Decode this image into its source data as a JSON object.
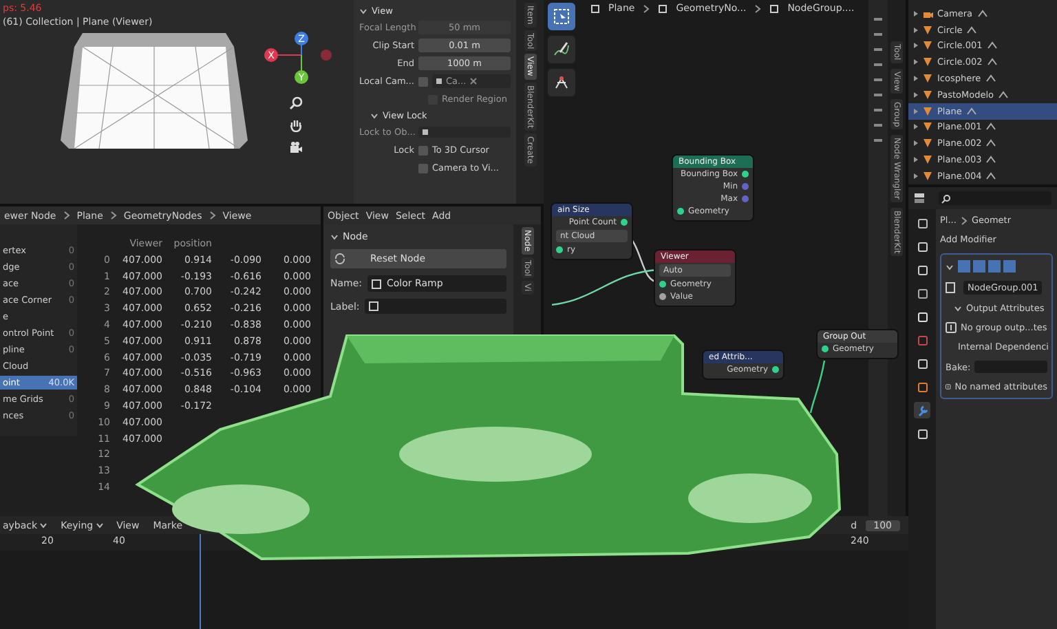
{
  "viewport": {
    "fps": "ps: 5.46",
    "info": "(61) Collection | Plane (Viewer)",
    "gizmo": [
      "X",
      "Y",
      "Z"
    ],
    "sidebar": {
      "section": "View",
      "fields": [
        {
          "label": "Focal Length",
          "value": "50 mm",
          "disabled": true
        },
        {
          "label": "Clip Start",
          "value": "0.01 m",
          "disabled": false
        },
        {
          "label": "End",
          "value": "1000 m",
          "disabled": false
        }
      ],
      "local_camera": {
        "label": "Local Cam...",
        "value": "Ca...",
        "checked": false
      },
      "render_region": {
        "label": "Render Region",
        "checked": false,
        "disabled": true
      },
      "view_lock": "View Lock",
      "lock_to_object": {
        "label": "Lock to Ob...",
        "disabled": true
      },
      "lock_label": "Lock",
      "lock_options": [
        {
          "label": "To 3D Cursor",
          "checked": false
        },
        {
          "label": "Camera to Vi...",
          "checked": false
        }
      ]
    },
    "tabs": [
      {
        "label": "Item",
        "selected": false
      },
      {
        "label": "Tool",
        "selected": false
      },
      {
        "label": "View",
        "selected": true
      },
      {
        "label": "BlenderKit",
        "selected": false
      },
      {
        "label": "Create",
        "selected": false
      }
    ]
  },
  "spreadsheet": {
    "breadcrumbs": [
      "ewer Node",
      "Plane",
      "GeometryNodes",
      "Viewe"
    ],
    "domains": [
      {
        "label": "ertex",
        "count": "0",
        "selected": false
      },
      {
        "label": "dge",
        "count": "0",
        "selected": false
      },
      {
        "label": "ace",
        "count": "0",
        "selected": false
      },
      {
        "label": "ace Corner",
        "count": "0",
        "selected": false
      },
      {
        "label": "e",
        "selected": false
      },
      {
        "label": "ontrol Point",
        "count": "0",
        "selected": false
      },
      {
        "label": "pline",
        "count": "0",
        "selected": false
      },
      {
        "label": "Cloud",
        "selected": false
      },
      {
        "label": "oint",
        "count": "40.0K",
        "selected": true
      },
      {
        "label": "me Grids",
        "count": "0",
        "selected": false
      },
      {
        "label": "nces",
        "count": "0",
        "selected": false
      }
    ],
    "columns": [
      "Viewer",
      "position"
    ],
    "rows": [
      {
        "index": "0",
        "cells": [
          "407.000",
          "0.914",
          "-0.090",
          "0.000"
        ]
      },
      {
        "index": "1",
        "cells": [
          "407.000",
          "-0.193",
          "-0.616",
          "0.000"
        ]
      },
      {
        "index": "2",
        "cells": [
          "407.000",
          "0.700",
          "-0.242",
          "0.000"
        ]
      },
      {
        "index": "3",
        "cells": [
          "407.000",
          "0.652",
          "-0.216",
          "0.000"
        ]
      },
      {
        "index": "4",
        "cells": [
          "407.000",
          "-0.210",
          "-0.838",
          "0.000"
        ]
      },
      {
        "index": "5",
        "cells": [
          "407.000",
          "0.911",
          "0.878",
          "0.000"
        ]
      },
      {
        "index": "6",
        "cells": [
          "407.000",
          "-0.035",
          "-0.719",
          "0.000"
        ]
      },
      {
        "index": "7",
        "cells": [
          "407.000",
          "-0.516",
          "-0.963",
          "0.000"
        ]
      },
      {
        "index": "8",
        "cells": [
          "407.000",
          "0.848",
          "-0.104",
          "0.000"
        ]
      },
      {
        "index": "9",
        "cells": [
          "407.000",
          "-0.172"
        ]
      },
      {
        "index": "10",
        "cells": [
          "407.000"
        ]
      },
      {
        "index": "11",
        "cells": [
          "407.000"
        ]
      },
      {
        "index": "12",
        "cells": []
      },
      {
        "index": "13",
        "cells": []
      },
      {
        "index": "14",
        "cells": []
      }
    ]
  },
  "node_panel": {
    "menus": [
      "Object",
      "View",
      "Select",
      "Add"
    ],
    "section": "Node",
    "reset": "Reset Node",
    "name_label": "Name:",
    "name_value": "Color Ramp",
    "label_label": "Label:",
    "tabs": [
      {
        "label": "Node",
        "selected": true
      },
      {
        "label": "Tool",
        "selected": false
      },
      {
        "label": "Vi",
        "selected": false
      }
    ]
  },
  "node_editor": {
    "breadcrumbs": [
      "Plane",
      "GeometryNo...",
      "NodeGroup...."
    ],
    "tools": [
      {
        "kind": "select",
        "selected": true
      },
      {
        "kind": "annotate",
        "selected": false
      },
      {
        "kind": "measure",
        "selected": false
      }
    ],
    "nodes": [
      {
        "title": "Bounding Box",
        "color": "#1d6e55",
        "sockets": [
          {
            "label": "Bounding Box",
            "kind": "output",
            "color": "#2fd28a"
          },
          {
            "label": "Min",
            "kind": "output",
            "color": "#6363c7"
          },
          {
            "label": "Max",
            "kind": "output",
            "color": "#6363c7"
          },
          {
            "label": "Geometry",
            "kind": "input",
            "color": "#2fd28a"
          }
        ]
      },
      {
        "title": "ain Size",
        "color": "#27365e",
        "sockets": [
          {
            "label": "Point Count",
            "kind": "output",
            "color": "#2fd28a"
          },
          {
            "label": "nt Cloud",
            "kind": "menu"
          },
          {
            "label": "ry",
            "kind": "input",
            "color": "#2fd28a"
          }
        ]
      },
      {
        "title": "Viewer",
        "color": "#6a2232",
        "sockets": [
          {
            "label": "Auto",
            "kind": "menu"
          },
          {
            "label": "Geometry",
            "kind": "input",
            "color": "#2fd28a"
          },
          {
            "label": "Value",
            "kind": "input",
            "color": "#a1a1a1"
          }
        ]
      },
      {
        "title": "ed Attrib...",
        "color": "#27365e",
        "sockets": [
          {
            "label": "Geometry",
            "kind": "output",
            "color": "#2fd28a"
          }
        ]
      },
      {
        "title": "Group Out",
        "color": "#3a3a3a",
        "sockets": [
          {
            "label": "Geometry",
            "kind": "input",
            "color": "#2fd28a"
          }
        ]
      }
    ],
    "sidebar_tabs": [
      "Tool",
      "View",
      "Group",
      "Node Wrangler",
      "BlenderKit"
    ]
  },
  "outliner": {
    "items": [
      {
        "name": "Camera",
        "kind": "camera",
        "selected": false
      },
      {
        "name": "Circle",
        "kind": "mesh",
        "selected": false
      },
      {
        "name": "Circle.001",
        "kind": "mesh",
        "selected": false
      },
      {
        "name": "Circle.002",
        "kind": "mesh",
        "selected": false
      },
      {
        "name": "Icosphere",
        "kind": "mesh",
        "selected": false
      },
      {
        "name": "PastoModelo",
        "kind": "mesh",
        "selected": false
      },
      {
        "name": "Plane",
        "kind": "mesh",
        "selected": true
      },
      {
        "name": "Plane.001",
        "kind": "mesh",
        "selected": false
      },
      {
        "name": "Plane.002",
        "kind": "mesh",
        "selected": false
      },
      {
        "name": "Plane.003",
        "kind": "mesh",
        "selected": false
      },
      {
        "name": "Plane.004",
        "kind": "mesh",
        "selected": false
      }
    ]
  },
  "properties": {
    "breadcrumbs": [
      "Pl...",
      "Geometr"
    ],
    "add_modifier": "Add Modifier",
    "node_group": "NodeGroup.001",
    "sections": [
      {
        "title": "Output Attributes",
        "expanded": true,
        "message": "No group outp...tes"
      },
      {
        "title": "Internal Dependenci",
        "expanded": true
      }
    ],
    "bake_label": "Bake:",
    "info": "No named attributes"
  },
  "timeline": {
    "menus": [
      {
        "label": "ayback",
        "dropdown": true
      },
      {
        "label": "Keying",
        "dropdown": true
      },
      {
        "label": "View",
        "dropdown": false
      },
      {
        "label": "Marke",
        "dropdown": false
      }
    ],
    "ruler": [
      "20",
      "40",
      "240"
    ],
    "end_label": "d",
    "end_value": "100"
  }
}
